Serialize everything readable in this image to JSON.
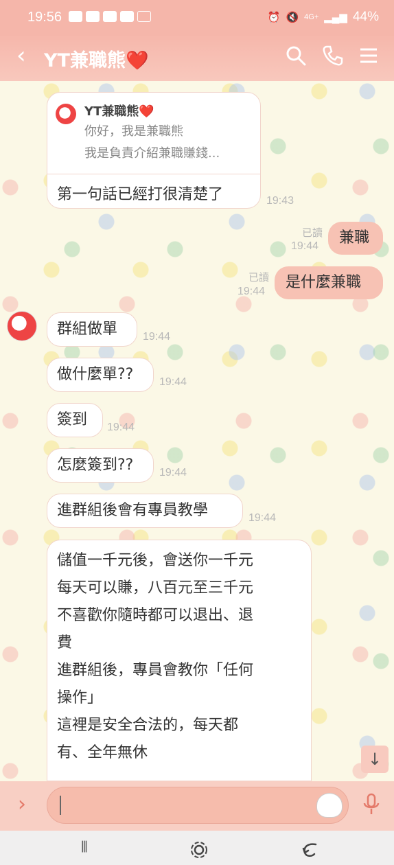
{
  "status_bar": {
    "time": "19:56",
    "network": "4G+",
    "battery": "44%"
  },
  "header": {
    "back_icon": "chevron-left-icon",
    "title": "YT兼職熊",
    "title_heart": "❤️",
    "search_icon": "search-icon",
    "call_icon": "phone-icon",
    "menu_icon": "menu-icon"
  },
  "reply_card": {
    "quoted_name": "YT兼職熊",
    "quoted_heart": "❤️",
    "quoted_line1": "你好，我是兼職熊",
    "quoted_line2": "我是負責介紹兼職賺錢...",
    "text": "第一句話已經打很清楚了",
    "time": "19:43"
  },
  "messages": [
    {
      "side": "right",
      "text": "兼職",
      "read": "已讀",
      "time": "19:44"
    },
    {
      "side": "right",
      "text": "是什麼兼職",
      "read": "已讀",
      "time": "19:44"
    },
    {
      "side": "left",
      "text": "群組做單",
      "time": "19:44"
    },
    {
      "side": "left",
      "text": "做什麼單??",
      "time": "19:44"
    },
    {
      "side": "left",
      "text": "簽到",
      "time": "19:44"
    },
    {
      "side": "left",
      "text": "怎麼簽到??",
      "time": "19:44"
    },
    {
      "side": "left",
      "text": "進群組後會有專員教學",
      "time": "19:44"
    }
  ],
  "long_message": {
    "lines": [
      "儲值一千元後，會送你一千元",
      "每天可以賺，八百元至三千元",
      "不喜歡你隨時都可以退出、退",
      "費",
      "進群組後，專員會教你「任何",
      "操作」",
      "這裡是安全合法的，每天都",
      "有、全年無休"
    ]
  },
  "input": {
    "placeholder": "",
    "value": ""
  },
  "colors": {
    "header": "#f6b7ab",
    "sent_bubble": "#f7c2b4",
    "received_bubble": "#ffffff"
  }
}
